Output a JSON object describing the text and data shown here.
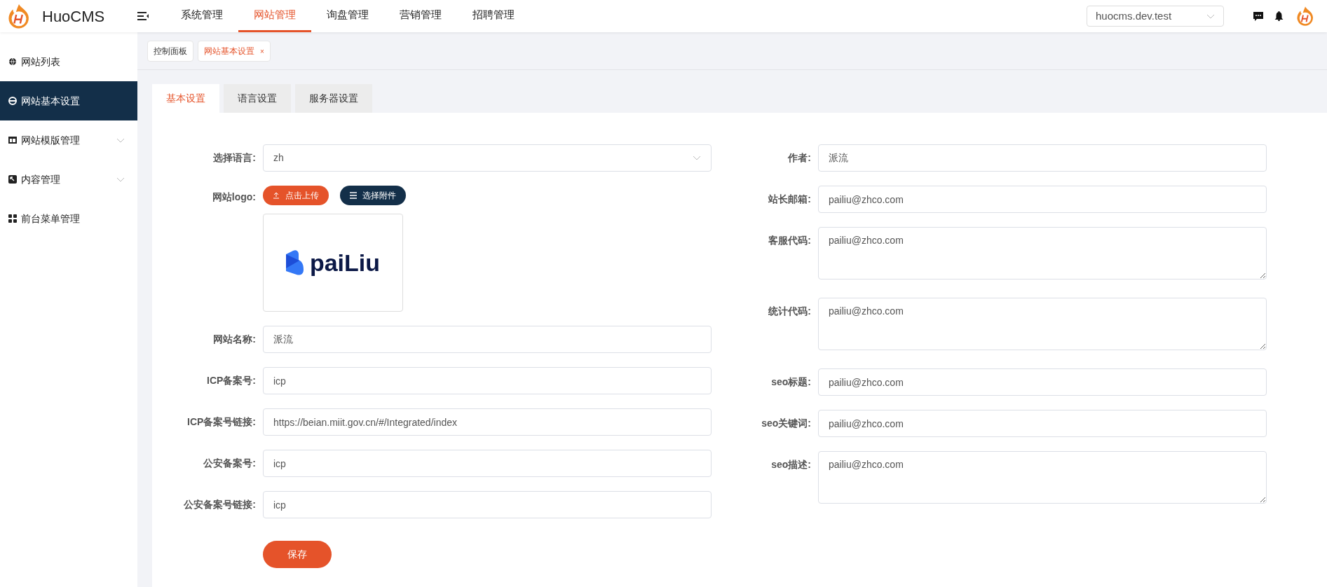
{
  "brand": {
    "name": "HuoCMS"
  },
  "top_nav": [
    {
      "label": "系统管理",
      "selected": false
    },
    {
      "label": "网站管理",
      "selected": true
    },
    {
      "label": "询盘管理",
      "selected": false
    },
    {
      "label": "营销管理",
      "selected": false
    },
    {
      "label": "招聘管理",
      "selected": false
    }
  ],
  "site_select": {
    "value": "huocms.dev.test"
  },
  "sidebar": {
    "items": [
      {
        "label": "网站列表",
        "selected": false,
        "expandable": false
      },
      {
        "label": "网站基本设置",
        "selected": true,
        "expandable": false
      },
      {
        "label": "网站模版管理",
        "selected": false,
        "expandable": true
      },
      {
        "label": "内容管理",
        "selected": false,
        "expandable": true
      },
      {
        "label": "前台菜单管理",
        "selected": false,
        "expandable": false
      }
    ]
  },
  "page_tags": [
    {
      "label": "控制面板",
      "selected": false,
      "closable": false
    },
    {
      "label": "网站基本设置",
      "selected": true,
      "closable": true,
      "close": "×"
    }
  ],
  "tabs": [
    {
      "label": "基本设置",
      "selected": true
    },
    {
      "label": "语言设置",
      "selected": false
    },
    {
      "label": "服务器设置",
      "selected": false
    }
  ],
  "left_fields": [
    {
      "kind": "select",
      "label": "选择语言:",
      "value": "zh"
    },
    {
      "kind": "logo",
      "label": "网站logo:",
      "upload": "点击上传",
      "attach": "选择附件",
      "preview_text": "paiLiu"
    },
    {
      "kind": "input",
      "label": "网站名称:",
      "value": "派流"
    },
    {
      "kind": "input",
      "label": "ICP备案号:",
      "value": "icp"
    },
    {
      "kind": "input",
      "label": "ICP备案号链接:",
      "value": "https://beian.miit.gov.cn/#/Integrated/index"
    },
    {
      "kind": "input",
      "label": "公安备案号:",
      "value": "icp"
    },
    {
      "kind": "input",
      "label": "公安备案号链接:",
      "value": "icp"
    }
  ],
  "save_button": "保存",
  "right_fields": [
    {
      "kind": "input",
      "label": "作者:",
      "value": "派流"
    },
    {
      "kind": "input",
      "label": "站长邮箱:",
      "value": "pailiu@zhco.com"
    },
    {
      "kind": "textarea",
      "label": "客服代码:",
      "value": "pailiu@zhco.com"
    },
    {
      "kind": "textarea",
      "label": "统计代码:",
      "value": "pailiu@zhco.com"
    },
    {
      "kind": "input",
      "label": "seo标题:",
      "value": "pailiu@zhco.com"
    },
    {
      "kind": "input",
      "label": "seo关键词:",
      "value": "pailiu@zhco.com"
    },
    {
      "kind": "textarea",
      "label": "seo描述:",
      "value": "pailiu@zhco.com"
    }
  ]
}
